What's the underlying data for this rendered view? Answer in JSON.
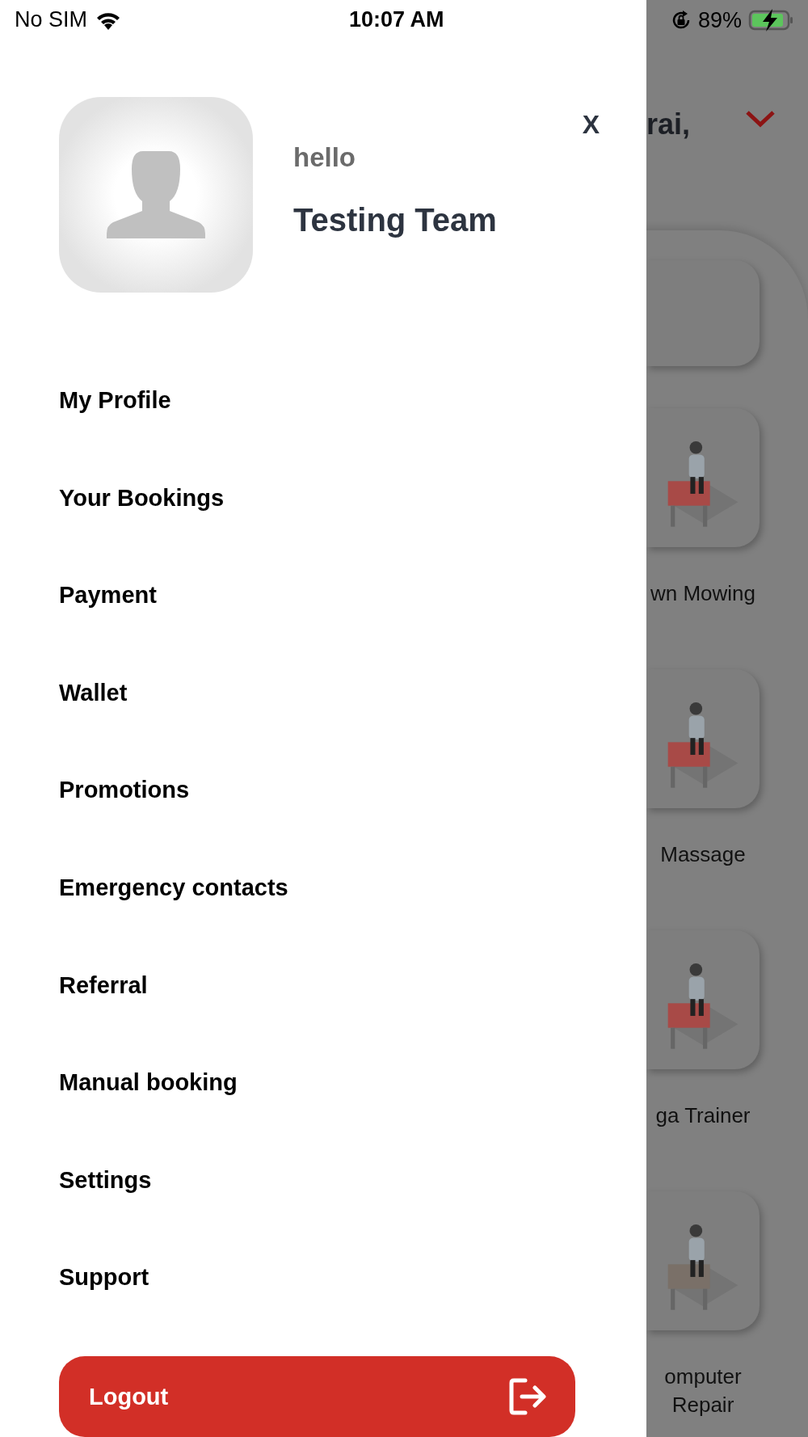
{
  "status_bar": {
    "carrier": "No SIM",
    "time": "10:07 AM",
    "battery": "89%"
  },
  "drawer": {
    "greeting": "hello",
    "user_name": "Testing Team",
    "close": "X",
    "menu": [
      {
        "label": "My Profile"
      },
      {
        "label": "Your Bookings"
      },
      {
        "label": "Payment"
      },
      {
        "label": "Wallet"
      },
      {
        "label": "Promotions"
      },
      {
        "label": "Emergency contacts"
      },
      {
        "label": "Referral"
      },
      {
        "label": "Manual booking"
      },
      {
        "label": "Settings"
      },
      {
        "label": "Support"
      }
    ],
    "logout": "Logout"
  },
  "background": {
    "header_text": "rai,",
    "services": [
      {
        "label_lines": [
          "wn Mowing"
        ]
      },
      {
        "label_lines": [
          "Massage"
        ]
      },
      {
        "label_lines": [
          "ga Trainer"
        ]
      },
      {
        "label_lines": [
          "omputer",
          "Repair"
        ]
      }
    ]
  }
}
